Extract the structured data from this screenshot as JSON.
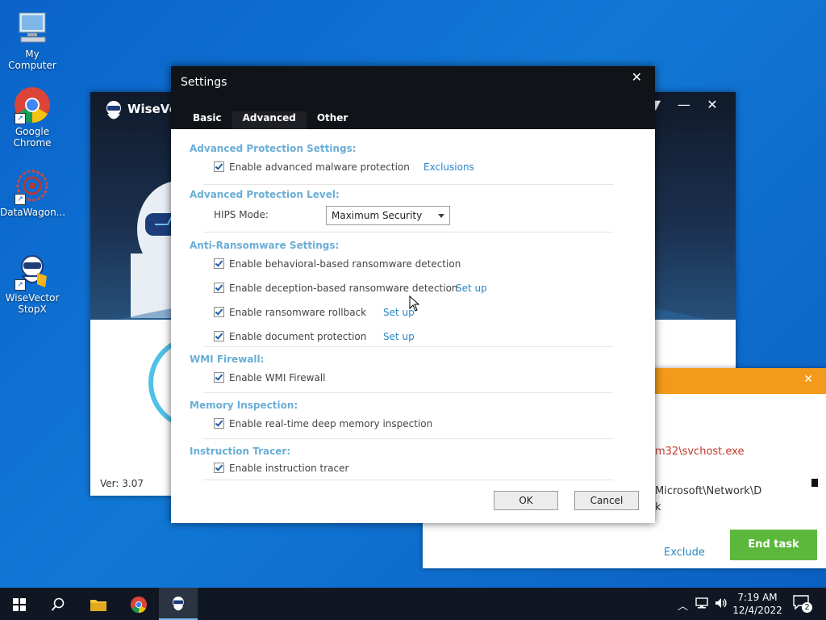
{
  "desktop": {
    "icons": [
      {
        "label": "My Computer"
      },
      {
        "label": "Google Chrome"
      },
      {
        "label": "DataWagon..."
      },
      {
        "label": "WiseVector StopX"
      }
    ]
  },
  "wisevector_window": {
    "title": "WiseVec",
    "version": "Ver: 3.07",
    "controls": {
      "menu": "▼",
      "minimize": "—",
      "close": "✕"
    }
  },
  "alert_window": {
    "path_line1": "m32\\svchost.exe",
    "path_line2": "Microsoft\\Network\\D",
    "path_line3": "k",
    "exclude_label": "Exclude",
    "end_task_label": "End task",
    "close": "✕"
  },
  "settings": {
    "title": "Settings",
    "close": "✕",
    "tabs": [
      {
        "label": "Basic",
        "active": false
      },
      {
        "label": "Advanced",
        "active": true
      },
      {
        "label": "Other",
        "active": false
      }
    ],
    "sections": {
      "adv_protection": {
        "title": "Advanced Protection Settings:",
        "enable_label": "Enable advanced malware protection",
        "exclusions_link": "Exclusions"
      },
      "protection_level": {
        "title": "Advanced Protection Level:",
        "hips_label": "HIPS Mode:",
        "hips_value": "Maximum Security"
      },
      "anti_ransomware": {
        "title": "Anti-Ransomware Settings:",
        "behavioral": "Enable behavioral-based ransomware detection",
        "deception": "Enable deception-based ransomware detection",
        "deception_link": "Set up",
        "rollback": "Enable ransomware rollback",
        "rollback_link": "Set up",
        "document": "Enable document protection",
        "document_link": "Set up"
      },
      "wmi": {
        "title": "WMI Firewall:",
        "enable_label": "Enable WMI Firewall"
      },
      "memory": {
        "title": "Memory Inspection:",
        "enable_label": "Enable real-time deep memory inspection"
      },
      "tracer": {
        "title": "Instruction Tracer:",
        "enable_label": "Enable instruction tracer"
      }
    },
    "ok_label": "OK",
    "cancel_label": "Cancel"
  },
  "taskbar": {
    "time": "7:19 AM",
    "date": "12/4/2022",
    "notification_count": "2"
  }
}
